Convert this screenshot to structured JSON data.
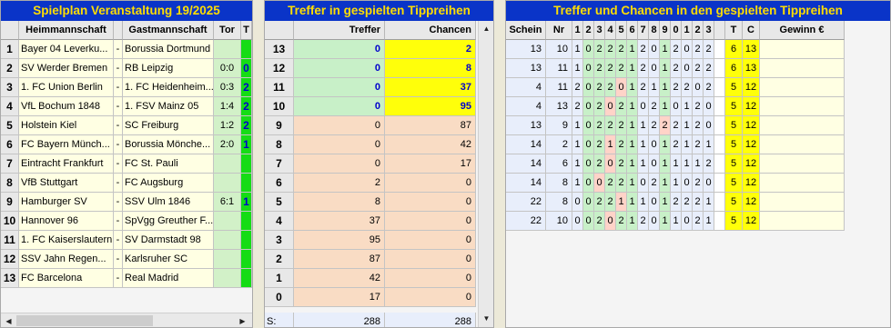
{
  "spielplan": {
    "title": "Spielplan Veranstaltung 19/2025",
    "headers": {
      "home": "Heimmannschaft",
      "away": "Gastmannschaft",
      "tor": "Tor",
      "t": "T"
    },
    "rows": [
      {
        "n": "1",
        "home": "Bayer 04 Leverku...",
        "away": "Borussia Dortmund",
        "tor": "",
        "t": ""
      },
      {
        "n": "2",
        "home": "SV Werder Bremen",
        "away": "RB Leipzig",
        "tor": "0:0",
        "t": "0"
      },
      {
        "n": "3",
        "home": "1. FC Union Berlin",
        "away": "1. FC Heidenheim...",
        "tor": "0:3",
        "t": "2"
      },
      {
        "n": "4",
        "home": "VfL Bochum 1848",
        "away": "1. FSV Mainz 05",
        "tor": "1:4",
        "t": "2"
      },
      {
        "n": "5",
        "home": "Holstein Kiel",
        "away": "SC Freiburg",
        "tor": "1:2",
        "t": "2"
      },
      {
        "n": "6",
        "home": "FC Bayern Münch...",
        "away": "Borussia Mönche...",
        "tor": "2:0",
        "t": "1"
      },
      {
        "n": "7",
        "home": "Eintracht Frankfurt",
        "away": "FC St. Pauli",
        "tor": "",
        "t": ""
      },
      {
        "n": "8",
        "home": "VfB Stuttgart",
        "away": "FC Augsburg",
        "tor": "",
        "t": ""
      },
      {
        "n": "9",
        "home": "Hamburger SV",
        "away": "SSV Ulm 1846",
        "tor": "6:1",
        "t": "1"
      },
      {
        "n": "10",
        "home": "Hannover 96",
        "away": "SpVgg Greuther F...",
        "tor": "",
        "t": ""
      },
      {
        "n": "11",
        "home": "1. FC Kaiserslautern",
        "away": "SV Darmstadt 98",
        "tor": "",
        "t": ""
      },
      {
        "n": "12",
        "home": "SSV Jahn Regen...",
        "away": "Karlsruher SC",
        "tor": "",
        "t": ""
      },
      {
        "n": "13",
        "home": "FC Barcelona",
        "away": "Real Madrid",
        "tor": "",
        "t": ""
      }
    ],
    "dash": "-"
  },
  "treffer": {
    "title": "Treffer in gespielten Tippreihen",
    "headers": {
      "treffer": "Treffer",
      "chancen": "Chancen"
    },
    "rows": [
      {
        "n": "13",
        "treffer": "0",
        "chancen": "2",
        "hi": true
      },
      {
        "n": "12",
        "treffer": "0",
        "chancen": "8",
        "hi": true
      },
      {
        "n": "11",
        "treffer": "0",
        "chancen": "37",
        "hi": true
      },
      {
        "n": "10",
        "treffer": "0",
        "chancen": "95",
        "hi": true
      },
      {
        "n": "9",
        "treffer": "0",
        "chancen": "87",
        "hi": false
      },
      {
        "n": "8",
        "treffer": "0",
        "chancen": "42",
        "hi": false
      },
      {
        "n": "7",
        "treffer": "0",
        "chancen": "17",
        "hi": false
      },
      {
        "n": "6",
        "treffer": "2",
        "chancen": "0",
        "hi": false
      },
      {
        "n": "5",
        "treffer": "8",
        "chancen": "0",
        "hi": false
      },
      {
        "n": "4",
        "treffer": "37",
        "chancen": "0",
        "hi": false
      },
      {
        "n": "3",
        "treffer": "95",
        "chancen": "0",
        "hi": false
      },
      {
        "n": "2",
        "treffer": "87",
        "chancen": "0",
        "hi": false
      },
      {
        "n": "1",
        "treffer": "42",
        "chancen": "0",
        "hi": false
      },
      {
        "n": "0",
        "treffer": "17",
        "chancen": "0",
        "hi": false
      }
    ],
    "sum": {
      "label": "S:",
      "treffer": "288",
      "chancen": "288"
    }
  },
  "chancen": {
    "title": "Treffer und Chancen in den gespielten Tippreihen",
    "headers": {
      "schein": "Schein",
      "nr": "Nr",
      "picks": [
        "1",
        "2",
        "3",
        "4",
        "5",
        "6",
        "7",
        "8",
        "9",
        "0",
        "1",
        "2",
        "3"
      ],
      "t": "T",
      "c": "C",
      "gewinn": "Gewinn €"
    },
    "rows": [
      {
        "schein": "13",
        "nr": "10",
        "p": [
          "1",
          "0",
          "2",
          "2",
          "2",
          "1",
          "2",
          "0",
          "1",
          "2",
          "0",
          "2",
          "2"
        ],
        "t": "6",
        "c": "13"
      },
      {
        "schein": "13",
        "nr": "11",
        "p": [
          "1",
          "0",
          "2",
          "2",
          "2",
          "1",
          "2",
          "0",
          "1",
          "2",
          "0",
          "2",
          "2"
        ],
        "t": "6",
        "c": "13"
      },
      {
        "schein": "4",
        "nr": "11",
        "p": [
          "2",
          "0",
          "2",
          "2",
          "0",
          "1",
          "2",
          "1",
          "1",
          "2",
          "2",
          "0",
          "2"
        ],
        "t": "5",
        "c": "12"
      },
      {
        "schein": "4",
        "nr": "13",
        "p": [
          "2",
          "0",
          "2",
          "0",
          "2",
          "1",
          "0",
          "2",
          "1",
          "0",
          "1",
          "2",
          "0"
        ],
        "t": "5",
        "c": "12"
      },
      {
        "schein": "13",
        "nr": "9",
        "p": [
          "1",
          "0",
          "2",
          "2",
          "2",
          "1",
          "1",
          "2",
          "2",
          "2",
          "1",
          "2",
          "0"
        ],
        "t": "5",
        "c": "12"
      },
      {
        "schein": "14",
        "nr": "2",
        "p": [
          "1",
          "0",
          "2",
          "1",
          "2",
          "1",
          "1",
          "0",
          "1",
          "2",
          "1",
          "2",
          "1"
        ],
        "t": "5",
        "c": "12"
      },
      {
        "schein": "14",
        "nr": "6",
        "p": [
          "1",
          "0",
          "2",
          "0",
          "2",
          "1",
          "1",
          "0",
          "1",
          "1",
          "1",
          "1",
          "2"
        ],
        "t": "5",
        "c": "12"
      },
      {
        "schein": "14",
        "nr": "8",
        "p": [
          "1",
          "0",
          "0",
          "2",
          "2",
          "1",
          "0",
          "2",
          "1",
          "1",
          "0",
          "2",
          "0"
        ],
        "t": "5",
        "c": "12"
      },
      {
        "schein": "22",
        "nr": "8",
        "p": [
          "0",
          "0",
          "2",
          "2",
          "1",
          "1",
          "1",
          "0",
          "1",
          "2",
          "2",
          "2",
          "1"
        ],
        "t": "5",
        "c": "12"
      },
      {
        "schein": "22",
        "nr": "10",
        "p": [
          "0",
          "0",
          "2",
          "0",
          "2",
          "1",
          "2",
          "0",
          "1",
          "1",
          "0",
          "2",
          "1"
        ],
        "t": "5",
        "c": "12"
      }
    ]
  },
  "colors": {
    "title_bg": "#0a34c8",
    "title_fg": "#ffde00",
    "hit_green": "#15dc15",
    "highlight_yellow": "#ffff0a"
  }
}
